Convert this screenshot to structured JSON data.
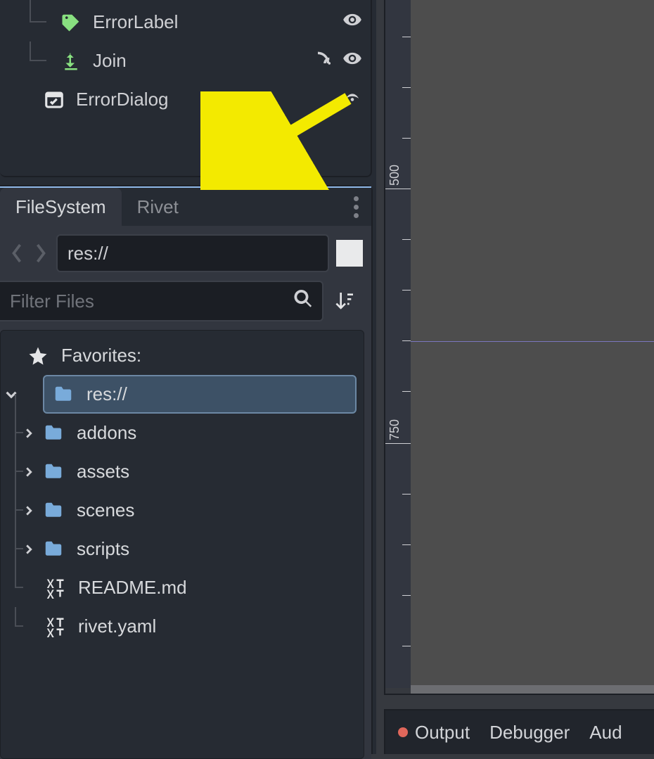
{
  "scene": {
    "nodes": [
      {
        "name": "ErrorLabel",
        "icon": "label-icon",
        "icon_color": "#88e080",
        "indent": 1,
        "has_signal": false,
        "has_visibility": true
      },
      {
        "name": "Join",
        "icon": "join-icon",
        "icon_color": "#88e080",
        "indent": 1,
        "has_signal": true,
        "has_visibility": true
      },
      {
        "name": "ErrorDialog",
        "icon": "dialog-icon",
        "icon_color": "#e4e5e7",
        "indent": 0,
        "has_signal": false,
        "has_visibility": false,
        "has_instance": true
      }
    ]
  },
  "filesystem_dock": {
    "tabs": [
      {
        "label": "FileSystem",
        "active": true
      },
      {
        "label": "Rivet",
        "active": false
      }
    ],
    "path_value": "res://",
    "filter_placeholder": "Filter Files",
    "tree": {
      "favorites_label": "Favorites:",
      "root_label": "res://",
      "items": [
        {
          "type": "folder",
          "label": "addons",
          "expandable": true
        },
        {
          "type": "folder",
          "label": "assets",
          "expandable": true
        },
        {
          "type": "folder",
          "label": "scenes",
          "expandable": true
        },
        {
          "type": "folder",
          "label": "scripts",
          "expandable": true
        },
        {
          "type": "file",
          "label": "README.md",
          "expandable": false
        },
        {
          "type": "file",
          "label": "rivet.yaml",
          "expandable": false
        }
      ]
    }
  },
  "viewport": {
    "ruler_major": [
      {
        "value": "500",
        "pos": 268
      },
      {
        "value": "750",
        "pos": 630
      }
    ]
  },
  "bottom_panel": {
    "output_label": "Output",
    "debugger_label": "Debugger",
    "audio_label": "Aud"
  }
}
